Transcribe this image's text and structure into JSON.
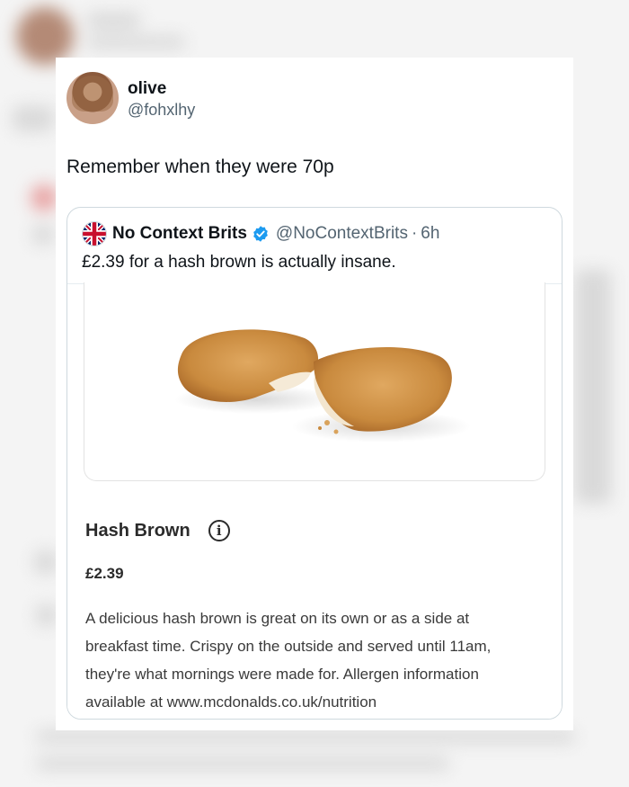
{
  "tweet": {
    "display_name": "olive",
    "handle": "@fohxlhy",
    "text": "Remember when they were 70p"
  },
  "quoted_tweet": {
    "display_name": "No Context Brits",
    "handle": "@NoContextBrits",
    "separator": "·",
    "time": "6h",
    "text": "£2.39 for a hash brown is actually insane.",
    "verified_icon": "verified-badge-icon",
    "avatar_icon": "union-jack-flag-icon"
  },
  "product": {
    "title": "Hash Brown",
    "info_icon": "info-icon",
    "price": "£2.39",
    "description": "A delicious hash brown is great on its own or as a side at breakfast time. Crispy on the outside and served until 11am, they're what mornings were made for. Allergen information available at www.mcdonalds.co.uk/nutrition"
  },
  "colors": {
    "text_primary": "#0f1419",
    "text_secondary": "#536471",
    "border": "#cfd9de",
    "verified_blue": "#1d9bf0"
  }
}
